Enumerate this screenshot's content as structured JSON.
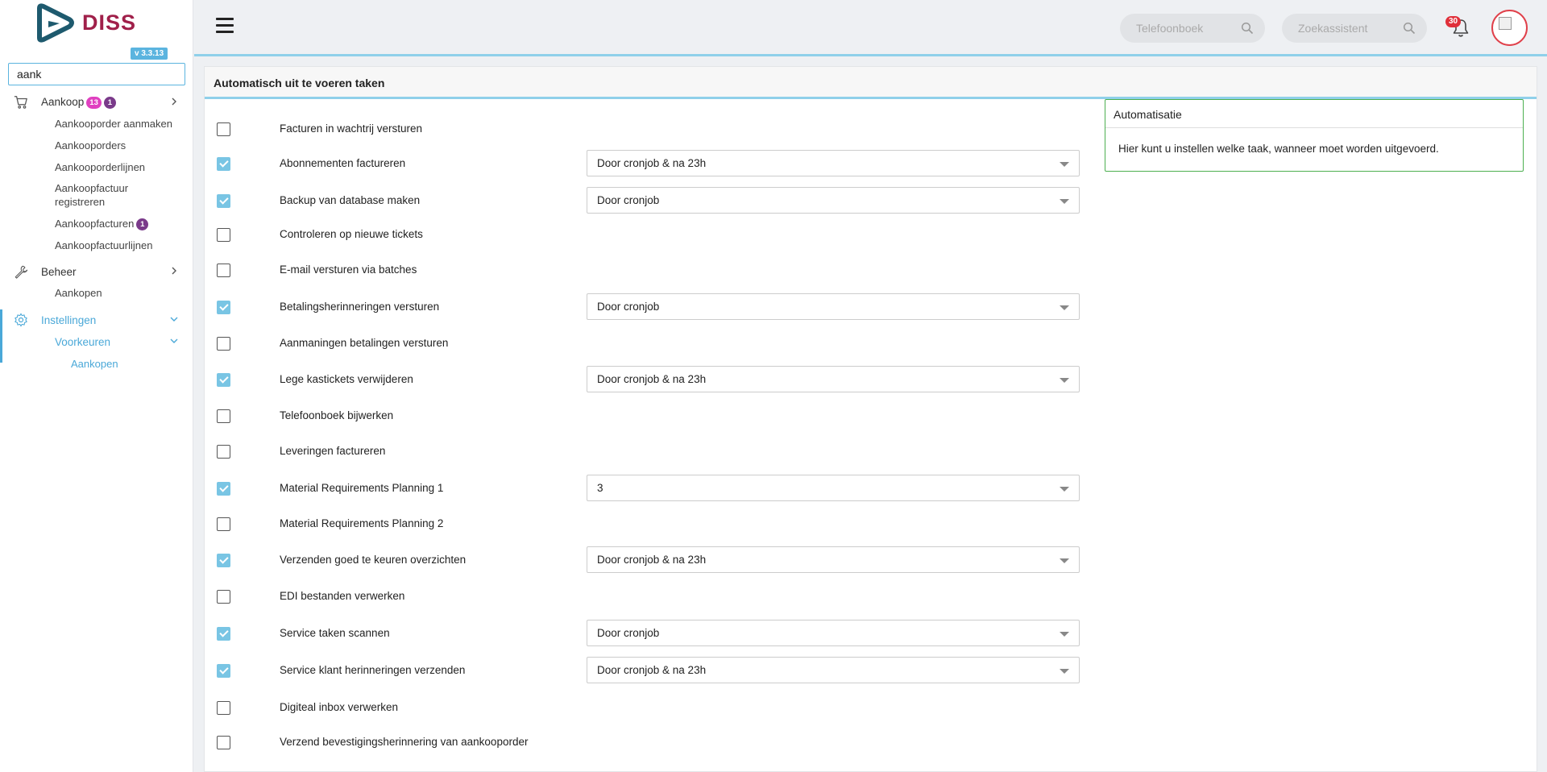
{
  "app": {
    "version": "v 3.3.13",
    "brand_colors": {
      "logo_dark": "#1e5a6e",
      "logo_text": "#a0204a",
      "accent": "#4aa8d8"
    }
  },
  "sidebar": {
    "search_value": "aank",
    "menu": [
      {
        "label": "Aankoop",
        "icon": "cart-icon",
        "badges": [
          "13",
          "1"
        ]
      },
      {
        "label": "Beheer",
        "icon": "wrench-icon"
      },
      {
        "label": "Instellingen",
        "icon": "gear-icon"
      }
    ],
    "aankoop_items": [
      {
        "label": "Aankooporder aanmaken"
      },
      {
        "label": "Aankooporders"
      },
      {
        "label": "Aankooporderlijnen"
      },
      {
        "label": "Aankoopfactuur registreren"
      },
      {
        "label": "Aankoopfacturen",
        "badge": "1"
      },
      {
        "label": "Aankoopfactuurlijnen"
      }
    ],
    "beheer_items": [
      {
        "label": "Aankopen"
      }
    ],
    "instellingen_items": [
      {
        "label": "Voorkeuren"
      }
    ],
    "voorkeuren_items": [
      {
        "label": "Aankopen"
      }
    ]
  },
  "header": {
    "phonebook_placeholder": "Telefoonboek",
    "assistant_placeholder": "Zoekassistent",
    "notification_count": "30"
  },
  "panel": {
    "title": "Automatisch uit te voeren taken",
    "tasks": [
      {
        "label": "Facturen in wachtrij versturen",
        "checked": false,
        "select": null
      },
      {
        "label": "Abonnementen factureren",
        "checked": true,
        "select": "Door cronjob & na 23h"
      },
      {
        "label": "Backup van database maken",
        "checked": true,
        "select": "Door cronjob"
      },
      {
        "label": "Controleren op nieuwe tickets",
        "checked": false,
        "select": null
      },
      {
        "label": "E-mail versturen via batches",
        "checked": false,
        "select": null
      },
      {
        "label": "Betalingsherinneringen versturen",
        "checked": true,
        "select": "Door cronjob"
      },
      {
        "label": "Aanmaningen betalingen versturen",
        "checked": false,
        "select": null
      },
      {
        "label": "Lege kastickets verwijderen",
        "checked": true,
        "select": "Door cronjob & na 23h"
      },
      {
        "label": "Telefoonboek bijwerken",
        "checked": false,
        "select": null
      },
      {
        "label": "Leveringen factureren",
        "checked": false,
        "select": null
      },
      {
        "label": "Material Requirements Planning 1",
        "checked": true,
        "select": "3"
      },
      {
        "label": "Material Requirements Planning 2",
        "checked": false,
        "select": null
      },
      {
        "label": "Verzenden goed te keuren overzichten",
        "checked": true,
        "select": "Door cronjob & na 23h"
      },
      {
        "label": "EDI bestanden verwerken",
        "checked": false,
        "select": null
      },
      {
        "label": "Service taken scannen",
        "checked": true,
        "select": "Door cronjob"
      },
      {
        "label": "Service klant herinneringen verzenden",
        "checked": true,
        "select": "Door cronjob & na 23h"
      },
      {
        "label": "Digiteal inbox verwerken",
        "checked": false,
        "select": null
      },
      {
        "label": "Verzend bevestigingsherinnering van aankooporder",
        "checked": false,
        "select": null
      }
    ]
  },
  "info": {
    "title": "Automatisatie",
    "text": "Hier kunt u instellen welke taak, wanneer moet worden uitgevoerd."
  }
}
